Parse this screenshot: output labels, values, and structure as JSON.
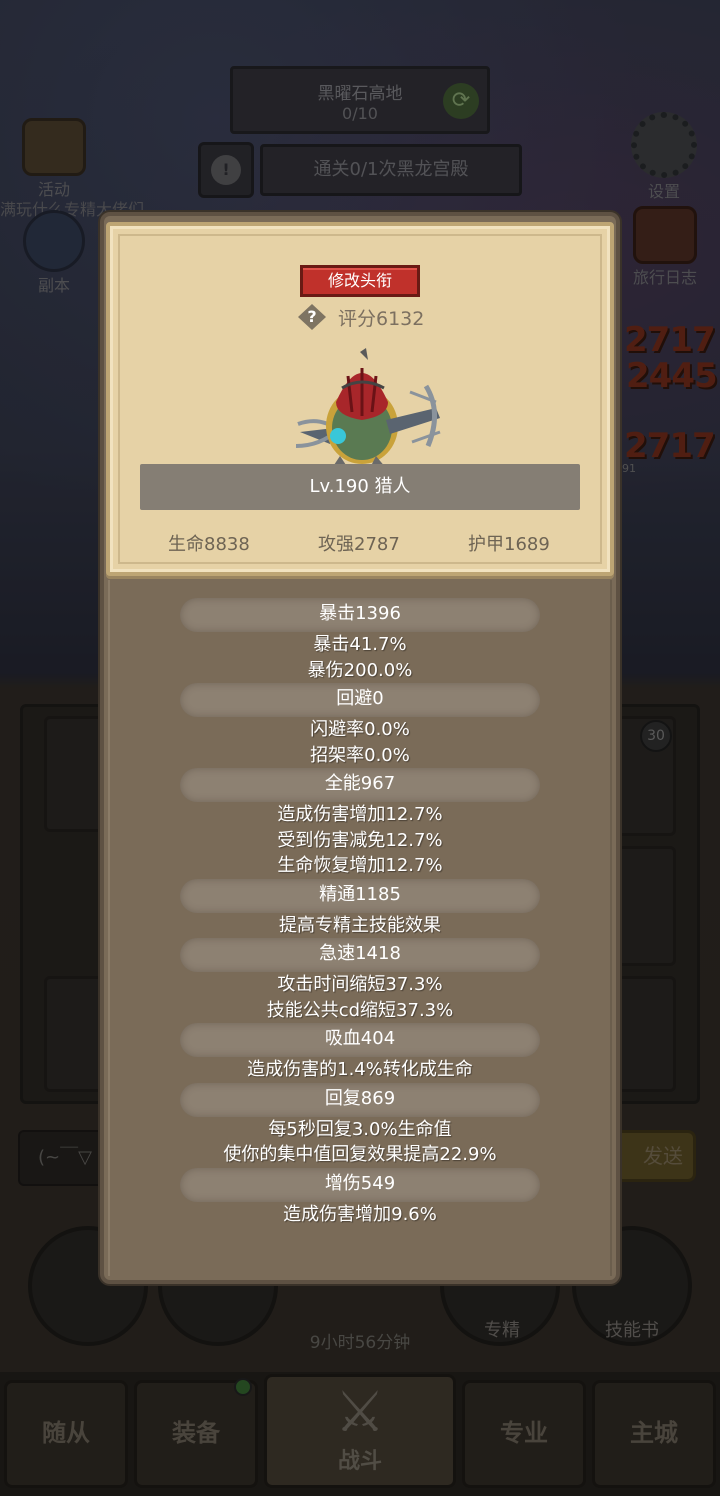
{
  "background": {
    "quest_title": "黑曜石高地",
    "quest_progress": "0/10",
    "quest_objective": "通关0/1次黑龙宫殿",
    "activity_label": "活动",
    "dungeon_label": "副本",
    "settings_label": "设置",
    "travel_log_label": "旅行日志",
    "chat_ticker": "满玩什么专精大佬们",
    "damage_numbers": [
      "2717",
      "2445",
      "2717"
    ],
    "small_num": "91",
    "slot_badge": "30",
    "chat_placeholder": "(~￣▽",
    "send_label": "发送",
    "specialty_label": "专精",
    "skillbook_label": "技能书",
    "timer": "9小时56分钟"
  },
  "tabs": {
    "followers": "随从",
    "equipment": "装备",
    "battle": "战斗",
    "profession": "专业",
    "main_city": "主城"
  },
  "profile": {
    "rename_button": "修改头衔",
    "help_symbol": "?",
    "score": "评分6132",
    "name_level": "Lv.190 猎人",
    "hp": "生命8838",
    "attack_power": "攻强2787",
    "armor": "护甲1689"
  },
  "stats": [
    {
      "header": "暴击1396",
      "lines": [
        "暴击41.7%",
        "暴伤200.0%"
      ]
    },
    {
      "header": "回避0",
      "lines": [
        "闪避率0.0%",
        "招架率0.0%"
      ]
    },
    {
      "header": "全能967",
      "lines": [
        "造成伤害增加12.7%",
        "受到伤害减免12.7%",
        "生命恢复增加12.7%"
      ]
    },
    {
      "header": "精通1185",
      "lines": [
        "提高专精主技能效果"
      ]
    },
    {
      "header": "急速1418",
      "lines": [
        "攻击时间缩短37.3%",
        "技能公共cd缩短37.3%"
      ]
    },
    {
      "header": "吸血404",
      "lines": [
        "造成伤害的1.4%转化成生命"
      ]
    },
    {
      "header": "回复869",
      "lines": [
        "每5秒回复3.0%生命值",
        "使你的集中值回复效果提高22.9%"
      ]
    },
    {
      "header": "增伤549",
      "lines": [
        "造成伤害增加9.6%"
      ]
    }
  ],
  "colors": {
    "rename_button": "#c0312b",
    "card": "#e6d2a6",
    "modal": "#7a6b58",
    "stat_pill": "#8d8172"
  }
}
